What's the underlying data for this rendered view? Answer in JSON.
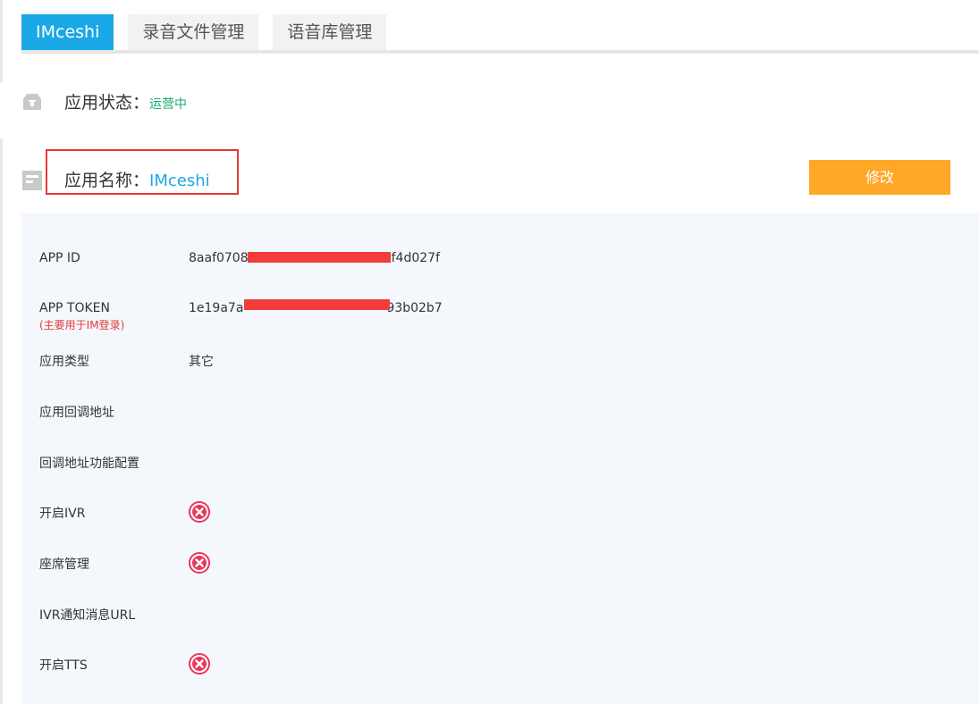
{
  "tabs": [
    {
      "label": "IMceshi",
      "active": true
    },
    {
      "label": "录音文件管理",
      "active": false
    },
    {
      "label": "语音库管理",
      "active": false
    }
  ],
  "app_status": {
    "label": "应用状态：",
    "value": "运营中"
  },
  "app_name": {
    "label": "应用名称：",
    "value": "IMceshi"
  },
  "edit_button": {
    "label": "修改"
  },
  "details": {
    "app_id": {
      "label": "APP ID",
      "value_start": "8aaf0708",
      "value_end": "f4d027f"
    },
    "app_token": {
      "label": "APP TOKEN",
      "note": "(主要用于IM登录)",
      "value_start": "1e19a7a",
      "value_end": "93b02b7"
    },
    "app_type": {
      "label": "应用类型",
      "value": "其它"
    },
    "callback_url": {
      "label": "应用回调地址",
      "value": ""
    },
    "callback_config": {
      "label": "回调地址功能配置",
      "value": ""
    },
    "enable_ivr": {
      "label": "开启IVR",
      "enabled": false
    },
    "seat_management": {
      "label": "座席管理",
      "enabled": false
    },
    "ivr_notify_url": {
      "label": "IVR通知消息URL",
      "value": ""
    },
    "enable_tts": {
      "label": "开启TTS",
      "enabled": false
    }
  },
  "colors": {
    "accent": "#1aa8e6",
    "status_green": "#1aab6e",
    "button_orange": "#ffa726",
    "error_red": "#e53935"
  }
}
